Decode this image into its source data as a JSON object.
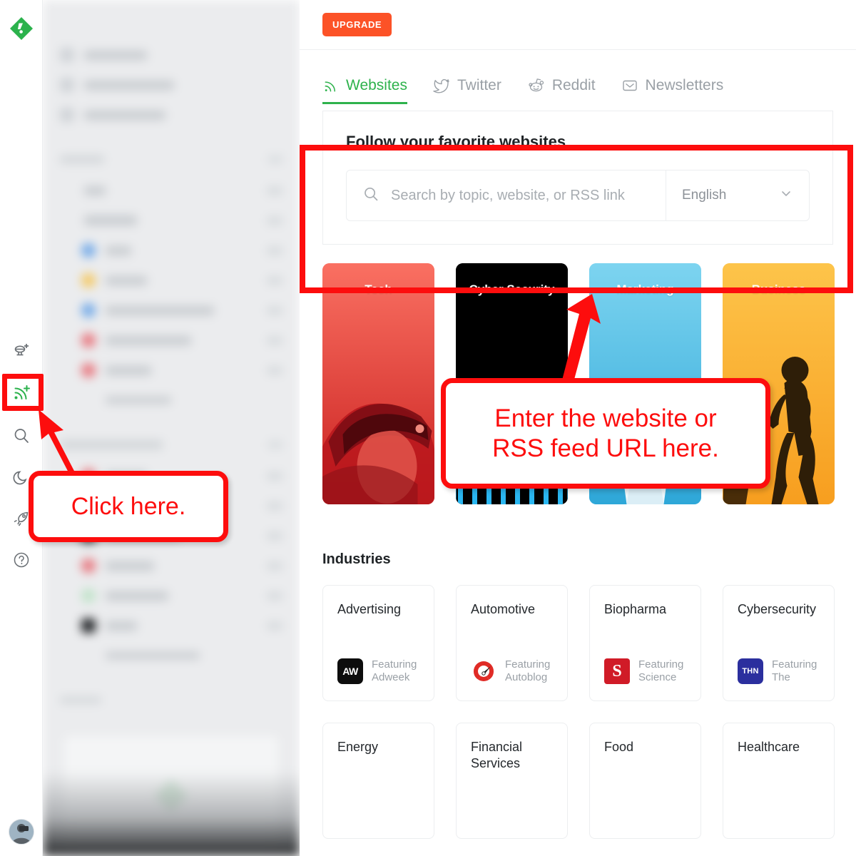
{
  "rail": {
    "logo_icon": "feedly-logo-icon",
    "icons": [
      {
        "name": "add-board-icon",
        "label": "Add board"
      },
      {
        "name": "add-feed-rss-icon",
        "label": "Add content"
      },
      {
        "name": "search-icon",
        "label": "Search"
      },
      {
        "name": "dark-mode-moon-icon",
        "label": "Dark mode"
      },
      {
        "name": "rocket-icon",
        "label": "Power search"
      },
      {
        "name": "help-icon",
        "label": "Help"
      }
    ],
    "avatar_label": "User avatar"
  },
  "topbar": {
    "upgrade_label": "UPGRADE"
  },
  "tabs": [
    {
      "label": "Websites",
      "icon": "rss-icon",
      "active": true
    },
    {
      "label": "Twitter",
      "icon": "twitter-bird-icon",
      "active": false
    },
    {
      "label": "Reddit",
      "icon": "reddit-alien-icon",
      "active": false
    },
    {
      "label": "Newsletters",
      "icon": "envelope-icon",
      "active": false
    }
  ],
  "discover": {
    "title": "Follow your favorite websites",
    "search_placeholder": "Search by topic, website, or RSS link",
    "search_value": "",
    "search_icon": "search-icon",
    "language_value": "English",
    "language_chevron": "chevron-down-icon"
  },
  "categories": [
    {
      "label": "Tech",
      "color": "#fa7062"
    },
    {
      "label": "Cyber Security",
      "color": "#000000"
    },
    {
      "label": "Marketing",
      "color": "#72cdec"
    },
    {
      "label": "Business",
      "color": "#fbbf3e"
    }
  ],
  "industries": {
    "title": "Industries",
    "cards": [
      {
        "name": "Advertising",
        "featuring": "Featuring\nAdweek",
        "logo_text": "AW",
        "logo_bg": "#0d0d0d",
        "logo_icon": "adweek-logo-icon"
      },
      {
        "name": "Automotive",
        "featuring": "Featuring\nAutoblog",
        "logo_text": "",
        "logo_bg": "#ffffff",
        "logo_icon": "autoblog-logo-icon"
      },
      {
        "name": "Biopharma",
        "featuring": "Featuring\nScience",
        "logo_text": "S",
        "logo_bg": "#d01b27",
        "logo_icon": "science-logo-icon"
      },
      {
        "name": "Cybersecurity",
        "featuring": "Featuring\nThe",
        "logo_text": "THN",
        "logo_bg": "#2b2f9e",
        "logo_icon": "thehackernews-logo-icon"
      }
    ],
    "row2": [
      {
        "name": "Energy"
      },
      {
        "name": "Financial Services"
      },
      {
        "name": "Food"
      },
      {
        "name": "Healthcare"
      }
    ]
  },
  "annotations": {
    "accent_color": "#fd0d0d",
    "click_here": "Click here.",
    "enter_url_line1": "Enter the website or",
    "enter_url_line2": "RSS feed URL here."
  }
}
